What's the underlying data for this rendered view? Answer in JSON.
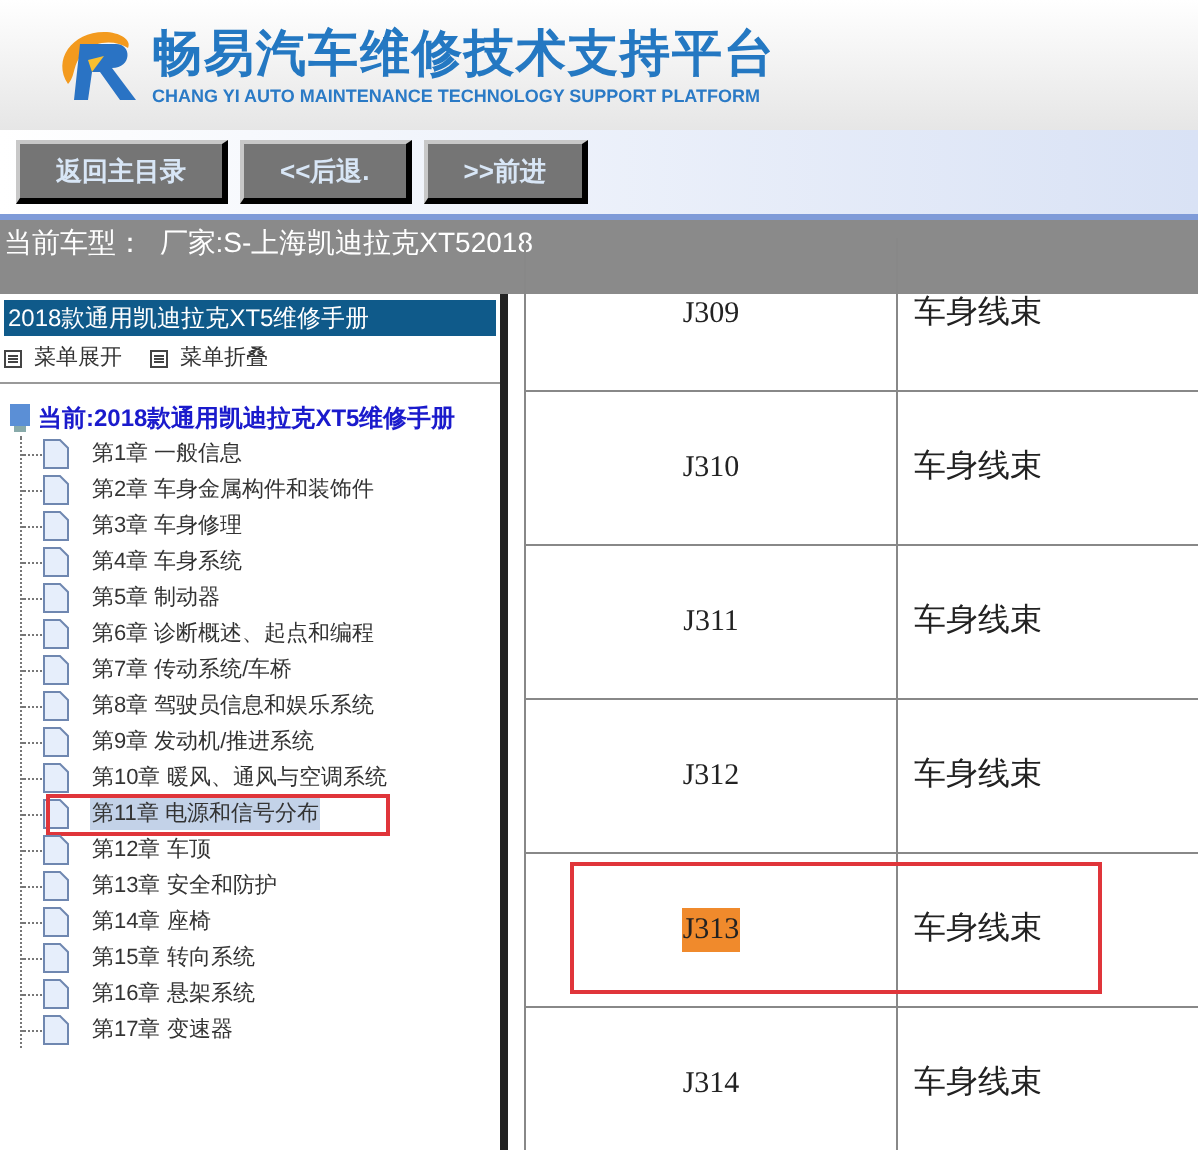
{
  "header": {
    "title": "畅易汽车维修技术支持平台",
    "subtitle": "CHANG YI AUTO MAINTENANCE TECHNOLOGY SUPPORT PLATFORM"
  },
  "toolbar": {
    "buttons": [
      "返回主目录",
      "<<后退.",
      ">>前进"
    ]
  },
  "current_model": "当前车型：  厂家:S-上海凯迪拉克XT52018",
  "sidebar": {
    "title": "2018款通用凯迪拉克XT5维修手册",
    "actions": [
      "菜单展开",
      "菜单折叠"
    ],
    "root": "当前:2018款通用凯迪拉克XT5维修手册",
    "items": [
      {
        "label": "第1章 一般信息",
        "selected": false,
        "boxed": false
      },
      {
        "label": "第2章 车身金属构件和装饰件",
        "selected": false,
        "boxed": false
      },
      {
        "label": "第3章 车身修理",
        "selected": false,
        "boxed": false
      },
      {
        "label": "第4章 车身系统",
        "selected": false,
        "boxed": false
      },
      {
        "label": "第5章 制动器",
        "selected": false,
        "boxed": false
      },
      {
        "label": "第6章 诊断概述、起点和编程",
        "selected": false,
        "boxed": false
      },
      {
        "label": "第7章 传动系统/车桥",
        "selected": false,
        "boxed": false
      },
      {
        "label": "第8章 驾驶员信息和娱乐系统",
        "selected": false,
        "boxed": false
      },
      {
        "label": "第9章 发动机/推进系统",
        "selected": false,
        "boxed": false
      },
      {
        "label": "第10章 暖风、通风与空调系统",
        "selected": false,
        "boxed": false
      },
      {
        "label": "第11章 电源和信号分布",
        "selected": true,
        "boxed": true
      },
      {
        "label": "第12章 车顶",
        "selected": false,
        "boxed": false
      },
      {
        "label": "第13章 安全和防护",
        "selected": false,
        "boxed": false
      },
      {
        "label": "第14章 座椅",
        "selected": false,
        "boxed": false
      },
      {
        "label": "第15章 转向系统",
        "selected": false,
        "boxed": false
      },
      {
        "label": "第16章 悬架系统",
        "selected": false,
        "boxed": false
      },
      {
        "label": "第17章 变速器",
        "selected": false,
        "boxed": false
      }
    ]
  },
  "table": {
    "rows": [
      {
        "code": "J309",
        "name": "车身线束",
        "highlighted": false,
        "boxed": false
      },
      {
        "code": "J310",
        "name": "车身线束",
        "highlighted": false,
        "boxed": false
      },
      {
        "code": "J311",
        "name": "车身线束",
        "highlighted": false,
        "boxed": false
      },
      {
        "code": "J312",
        "name": "车身线束",
        "highlighted": false,
        "boxed": false
      },
      {
        "code": "J313",
        "name": "车身线束",
        "highlighted": true,
        "boxed": true
      },
      {
        "code": "J314",
        "name": "车身线束",
        "highlighted": false,
        "boxed": false
      }
    ]
  }
}
